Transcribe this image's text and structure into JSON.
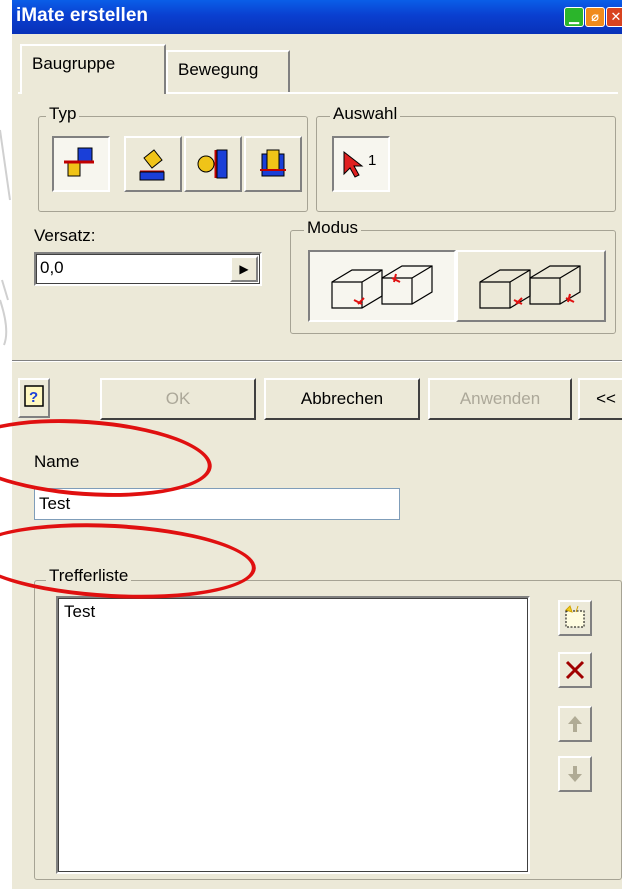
{
  "window": {
    "title": "iMate erstellen"
  },
  "tabs": [
    {
      "label": "Baugruppe",
      "active": true
    },
    {
      "label": "Bewegung",
      "active": false
    }
  ],
  "typ": {
    "label": "Typ",
    "buttons": [
      "mate-icon",
      "angle-icon",
      "tangent-icon",
      "insert-icon"
    ]
  },
  "auswahl": {
    "label": "Auswahl",
    "count": "1"
  },
  "versatz": {
    "label": "Versatz:",
    "value": "0,0"
  },
  "modus": {
    "label": "Modus"
  },
  "buttons": {
    "ok": "OK",
    "cancel": "Abbrechen",
    "apply": "Anwenden",
    "more": "<<"
  },
  "name": {
    "label": "Name",
    "value": "Test"
  },
  "trefferliste": {
    "label": "Trefferliste",
    "items": [
      "Test"
    ]
  },
  "colors": {
    "title_bar": "#0a3fd0",
    "dialog_bg": "#ece9d8",
    "annotation": "#e01010"
  }
}
